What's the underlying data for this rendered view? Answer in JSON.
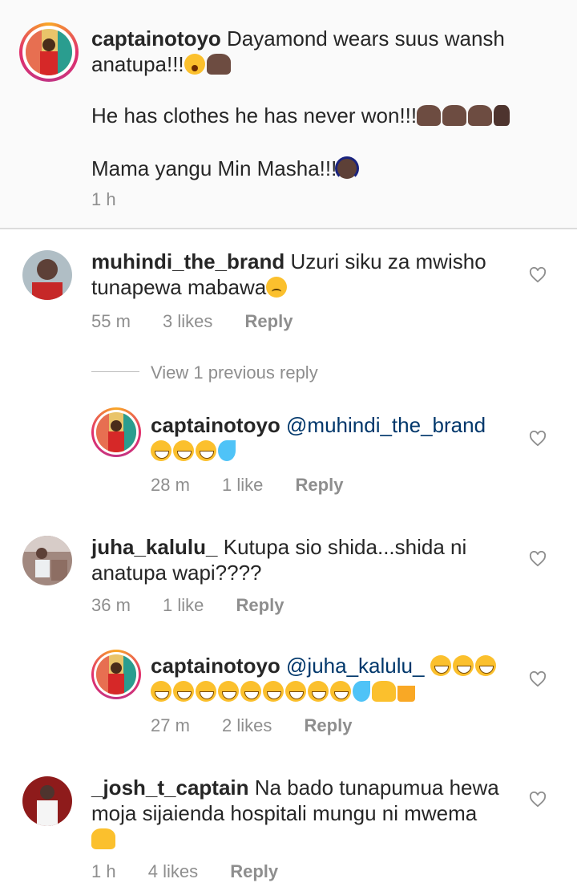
{
  "comments": [
    {
      "username": "captainotoyo",
      "lines": [
        "Dayamond wears suus wansh",
        "anatupa!!!"
      ],
      "line2": "He has clothes he has never won!!!",
      "line3": "Mama yangu Min Masha!!!",
      "time": "1 h"
    },
    {
      "username": "muhindi_the_brand",
      "text_a": "Uzuri siku za mwisho",
      "text_b": "tunapewa mabawa",
      "time": "55 m",
      "likes": "3 likes",
      "reply": "Reply"
    },
    {
      "view_replies": "View 1 previous reply"
    },
    {
      "username": "captainotoyo",
      "mention": "@muhindi_the_brand",
      "time": "28 m",
      "likes": "1 like",
      "reply": "Reply"
    },
    {
      "username": "juha_kalulu_",
      "text_a": "Kutupa sio shida...shida ni",
      "text_b": "anatupa wapi????",
      "time": "36 m",
      "likes": "1 like",
      "reply": "Reply"
    },
    {
      "username": "captainotoyo",
      "mention": "@juha_kalulu_",
      "time": "27 m",
      "likes": "2 likes",
      "reply": "Reply"
    },
    {
      "username": "_josh_t_captain",
      "text_a": "Na bado tunapumua hewa",
      "text_b": "moja sijaienda hospitali mungu ni mwema",
      "time": "1 h",
      "likes": "4 likes",
      "reply": "Reply"
    }
  ],
  "icons": {
    "like": "heart-outline-icon",
    "emoji_colors": {
      "laugh": "#fbc02d",
      "drops": "#4fc3f7"
    }
  }
}
